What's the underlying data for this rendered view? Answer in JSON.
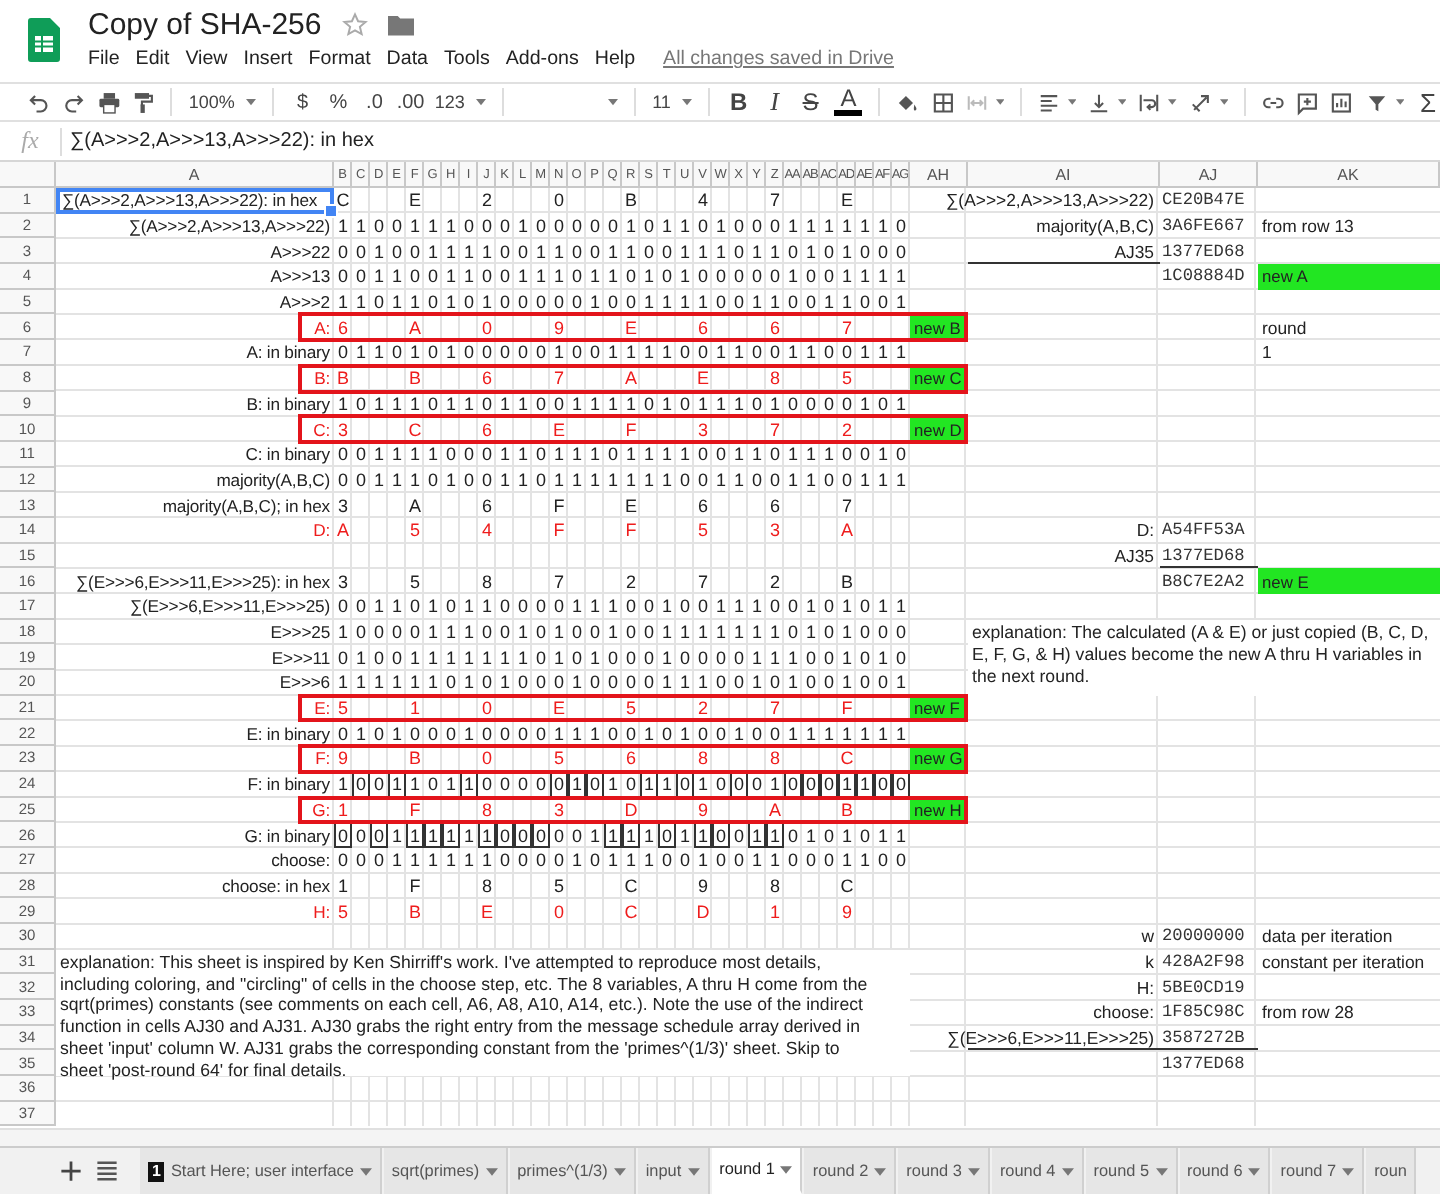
{
  "title": "Copy of SHA-256",
  "menu": [
    "File",
    "Edit",
    "View",
    "Insert",
    "Format",
    "Data",
    "Tools",
    "Add-ons",
    "Help"
  ],
  "save_status": "All changes saved in Drive",
  "toolbar": {
    "zoom": "100%",
    "currency": "$",
    "percent": "%",
    "decrease_decimals": ".0",
    "increase_decimals": ".00",
    "number_format": "123",
    "font_size": "11",
    "bold": "B",
    "italic": "I",
    "strikethrough": "S",
    "text_color": "A",
    "functions": "Σ"
  },
  "formula_bar": {
    "label": "fx",
    "value": "∑(A>>>2,A>>>13,A>>>22): in hex"
  },
  "column_headers": [
    "A",
    "B",
    "C",
    "D",
    "E",
    "F",
    "G",
    "H",
    "I",
    "J",
    "K",
    "L",
    "M",
    "N",
    "O",
    "P",
    "Q",
    "R",
    "S",
    "T",
    "U",
    "V",
    "W",
    "X",
    "Y",
    "Z",
    "AA",
    "AB",
    "AC",
    "AD",
    "AE",
    "AF",
    "AG",
    "AH",
    "AI",
    "AJ",
    "AK"
  ],
  "sheet_rows": [
    {
      "number": "1",
      "label": "∑(A>>>2,A>>>13,A>>>22): in hex",
      "kind": "hex",
      "selected": true,
      "values": [
        "C",
        "E",
        "2",
        "0",
        "B",
        "4",
        "7",
        "E"
      ],
      "side_label": "∑(A>>>2,A>>>13,A>>>22)",
      "side_value": "CE20B47E"
    },
    {
      "number": "2",
      "label": "∑(A>>>2,A>>>13,A>>>22)",
      "kind": "binary",
      "selected": false,
      "bits": [
        "1",
        "1",
        "0",
        "0",
        "1",
        "1",
        "1",
        "0",
        "0",
        "0",
        "1",
        "0",
        "0",
        "0",
        "0",
        "0",
        "1",
        "0",
        "1",
        "1",
        "0",
        "1",
        "0",
        "0",
        "0",
        "1",
        "1",
        "1",
        "1",
        "1",
        "1",
        "0"
      ],
      "side_label": "majority(A,B,C)",
      "side_value": "3A6FE667",
      "side_note": {
        "text": "from row 13",
        "kind": "plain"
      }
    },
    {
      "number": "3",
      "label": "A>>>22",
      "kind": "binary",
      "selected": false,
      "bits": [
        "0",
        "0",
        "1",
        "0",
        "0",
        "1",
        "1",
        "1",
        "1",
        "0",
        "0",
        "1",
        "1",
        "0",
        "0",
        "1",
        "1",
        "0",
        "0",
        "1",
        "1",
        "1",
        "0",
        "1",
        "1",
        "0",
        "1",
        "0",
        "1",
        "0",
        "0",
        "0"
      ],
      "side_label": "AJ35",
      "side_value": "1377ED68",
      "label_underlined": true,
      "value_underlined": false
    },
    {
      "number": "4",
      "label": "A>>>13",
      "kind": "binary",
      "selected": false,
      "bits": [
        "0",
        "0",
        "1",
        "1",
        "0",
        "0",
        "1",
        "1",
        "0",
        "0",
        "1",
        "1",
        "1",
        "0",
        "1",
        "1",
        "0",
        "1",
        "0",
        "1",
        "0",
        "0",
        "0",
        "0",
        "0",
        "1",
        "0",
        "0",
        "1",
        "1",
        "1",
        "1"
      ],
      "side_value": "1C08884D",
      "side_note": {
        "text": "new A",
        "kind": "tag"
      }
    },
    {
      "number": "5",
      "label": "A>>>2",
      "kind": "binary",
      "selected": false,
      "bits": [
        "1",
        "1",
        "0",
        "1",
        "1",
        "0",
        "1",
        "0",
        "1",
        "0",
        "0",
        "0",
        "0",
        "0",
        "1",
        "0",
        "0",
        "1",
        "1",
        "1",
        "1",
        "0",
        "0",
        "1",
        "1",
        "0",
        "0",
        "1",
        "1",
        "0",
        "0",
        "1"
      ]
    },
    {
      "number": "6",
      "label": "A:",
      "kind": "variable",
      "selected": false,
      "boxed": true,
      "tag": "new B",
      "values": [
        "6",
        "A",
        "0",
        "9",
        "E",
        "6",
        "6",
        "7"
      ],
      "side_note": {
        "text": "round",
        "kind": "plain"
      }
    },
    {
      "number": "7",
      "label": "A: in binary",
      "kind": "binary",
      "selected": false,
      "bits": [
        "0",
        "1",
        "1",
        "0",
        "1",
        "0",
        "1",
        "0",
        "0",
        "0",
        "0",
        "0",
        "1",
        "0",
        "0",
        "1",
        "1",
        "1",
        "1",
        "0",
        "0",
        "1",
        "1",
        "0",
        "0",
        "1",
        "1",
        "0",
        "0",
        "1",
        "1",
        "1"
      ],
      "side_note": {
        "text": "1",
        "kind": "plain"
      }
    },
    {
      "number": "8",
      "label": "B:",
      "kind": "variable",
      "selected": false,
      "boxed": true,
      "tag": "new C",
      "values": [
        "B",
        "B",
        "6",
        "7",
        "A",
        "E",
        "8",
        "5"
      ]
    },
    {
      "number": "9",
      "label": "B: in binary",
      "kind": "binary",
      "selected": false,
      "bits": [
        "1",
        "0",
        "1",
        "1",
        "1",
        "0",
        "1",
        "1",
        "0",
        "1",
        "1",
        "0",
        "0",
        "1",
        "1",
        "1",
        "1",
        "0",
        "1",
        "0",
        "1",
        "1",
        "1",
        "0",
        "1",
        "0",
        "0",
        "0",
        "0",
        "1",
        "0",
        "1"
      ]
    },
    {
      "number": "10",
      "label": "C:",
      "kind": "variable",
      "selected": false,
      "boxed": true,
      "tag": "new D",
      "values": [
        "3",
        "C",
        "6",
        "E",
        "F",
        "3",
        "7",
        "2"
      ]
    },
    {
      "number": "11",
      "label": "C: in binary",
      "kind": "binary",
      "selected": false,
      "bits": [
        "0",
        "0",
        "1",
        "1",
        "1",
        "1",
        "0",
        "0",
        "0",
        "1",
        "1",
        "0",
        "1",
        "1",
        "1",
        "0",
        "1",
        "1",
        "1",
        "1",
        "0",
        "0",
        "1",
        "1",
        "0",
        "1",
        "1",
        "1",
        "0",
        "0",
        "1",
        "0"
      ]
    },
    {
      "number": "12",
      "label": "majority(A,B,C)",
      "kind": "binary",
      "selected": false,
      "bits": [
        "0",
        "0",
        "1",
        "1",
        "1",
        "0",
        "1",
        "0",
        "0",
        "1",
        "1",
        "0",
        "1",
        "1",
        "1",
        "1",
        "1",
        "1",
        "1",
        "0",
        "0",
        "1",
        "1",
        "0",
        "0",
        "1",
        "1",
        "0",
        "0",
        "1",
        "1",
        "1"
      ]
    },
    {
      "number": "13",
      "label": "majority(A,B,C); in hex",
      "kind": "hex",
      "selected": false,
      "values": [
        "3",
        "A",
        "6",
        "F",
        "E",
        "6",
        "6",
        "7"
      ]
    },
    {
      "number": "14",
      "label": "D:",
      "kind": "variable",
      "selected": false,
      "boxed": false,
      "values": [
        "A",
        "5",
        "4",
        "F",
        "F",
        "5",
        "3",
        "A"
      ],
      "side_label": "D:",
      "side_value": "A54FF53A"
    },
    {
      "number": "15",
      "kind": "blank",
      "selected": false,
      "side_label": "AJ35",
      "side_value": "1377ED68",
      "label_underlined": false,
      "value_underlined": true
    },
    {
      "number": "16",
      "label": "∑(E>>>6,E>>>11,E>>>25): in hex",
      "kind": "hex",
      "selected": false,
      "values": [
        "3",
        "5",
        "8",
        "7",
        "2",
        "7",
        "2",
        "B"
      ],
      "side_value": "B8C7E2A2",
      "side_note": {
        "text": "new E",
        "kind": "tag"
      }
    },
    {
      "number": "17",
      "label": "∑(E>>>6,E>>>11,E>>>25)",
      "kind": "binary",
      "selected": false,
      "bits": [
        "0",
        "0",
        "1",
        "1",
        "0",
        "1",
        "0",
        "1",
        "1",
        "0",
        "0",
        "0",
        "0",
        "1",
        "1",
        "1",
        "0",
        "0",
        "1",
        "0",
        "0",
        "1",
        "1",
        "1",
        "0",
        "0",
        "1",
        "0",
        "1",
        "0",
        "1",
        "1"
      ]
    },
    {
      "number": "18",
      "label": "E>>>25",
      "kind": "binary",
      "selected": false,
      "bits": [
        "1",
        "0",
        "0",
        "0",
        "0",
        "1",
        "1",
        "1",
        "0",
        "0",
        "1",
        "0",
        "1",
        "0",
        "0",
        "1",
        "0",
        "0",
        "1",
        "1",
        "1",
        "1",
        "1",
        "1",
        "1",
        "0",
        "1",
        "0",
        "1",
        "0",
        "0",
        "0"
      ],
      "note": {
        "text": "explanation:  The calculated (A & E) or just copied (B, C, D, E, F, G, & H) values become the new A thru H variables in the next round.",
        "kind": "side"
      }
    },
    {
      "number": "19",
      "label": "E>>>11",
      "kind": "binary",
      "selected": false,
      "bits": [
        "0",
        "1",
        "0",
        "0",
        "1",
        "1",
        "1",
        "1",
        "1",
        "1",
        "1",
        "0",
        "1",
        "0",
        "1",
        "0",
        "0",
        "0",
        "1",
        "0",
        "0",
        "0",
        "0",
        "1",
        "1",
        "1",
        "0",
        "0",
        "1",
        "0",
        "1",
        "0"
      ]
    },
    {
      "number": "20",
      "label": "E>>>6",
      "kind": "binary",
      "selected": false,
      "bits": [
        "1",
        "1",
        "1",
        "1",
        "1",
        "1",
        "0",
        "1",
        "0",
        "1",
        "0",
        "0",
        "0",
        "1",
        "0",
        "0",
        "0",
        "0",
        "1",
        "1",
        "1",
        "0",
        "0",
        "1",
        "0",
        "1",
        "0",
        "0",
        "1",
        "0",
        "0",
        "1"
      ]
    },
    {
      "number": "21",
      "label": "E:",
      "kind": "variable",
      "selected": false,
      "boxed": true,
      "tag": "new F",
      "values": [
        "5",
        "1",
        "0",
        "E",
        "5",
        "2",
        "7",
        "F"
      ]
    },
    {
      "number": "22",
      "label": "E: in binary",
      "kind": "binary",
      "selected": false,
      "bits": [
        "0",
        "1",
        "0",
        "1",
        "0",
        "0",
        "0",
        "1",
        "0",
        "0",
        "0",
        "0",
        "1",
        "1",
        "1",
        "0",
        "0",
        "1",
        "0",
        "1",
        "0",
        "0",
        "1",
        "0",
        "0",
        "1",
        "1",
        "1",
        "1",
        "1",
        "1",
        "1"
      ]
    },
    {
      "number": "23",
      "label": "F:",
      "kind": "variable",
      "selected": false,
      "boxed": true,
      "tag": "new G",
      "values": [
        "9",
        "B",
        "0",
        "5",
        "6",
        "8",
        "8",
        "C"
      ]
    },
    {
      "number": "24",
      "label": "F: in binary",
      "kind": "binary",
      "selected": false,
      "bits": [
        {
          "digit": "1",
          "circled": false
        },
        {
          "digit": "0",
          "circled": true
        },
        {
          "digit": "0",
          "circled": false
        },
        {
          "digit": "1",
          "circled": true
        },
        {
          "digit": "1",
          "circled": false
        },
        {
          "digit": "0",
          "circled": false
        },
        {
          "digit": "1",
          "circled": false
        },
        {
          "digit": "1",
          "circled": true
        },
        {
          "digit": "0",
          "circled": false
        },
        {
          "digit": "0",
          "circled": false
        },
        {
          "digit": "0",
          "circled": false
        },
        {
          "digit": "0",
          "circled": false
        },
        {
          "digit": "0",
          "circled": true
        },
        {
          "digit": "1",
          "circled": true
        },
        {
          "digit": "0",
          "circled": true
        },
        {
          "digit": "1",
          "circled": false
        },
        {
          "digit": "0",
          "circled": false
        },
        {
          "digit": "1",
          "circled": true
        },
        {
          "digit": "1",
          "circled": false
        },
        {
          "digit": "0",
          "circled": true
        },
        {
          "digit": "1",
          "circled": false
        },
        {
          "digit": "0",
          "circled": false
        },
        {
          "digit": "0",
          "circled": true
        },
        {
          "digit": "0",
          "circled": false
        },
        {
          "digit": "1",
          "circled": false
        },
        {
          "digit": "0",
          "circled": true
        },
        {
          "digit": "0",
          "circled": true
        },
        {
          "digit": "0",
          "circled": true
        },
        {
          "digit": "1",
          "circled": true
        },
        {
          "digit": "1",
          "circled": true
        },
        {
          "digit": "0",
          "circled": true
        },
        {
          "digit": "0",
          "circled": true
        }
      ]
    },
    {
      "number": "25",
      "label": "G:",
      "kind": "variable",
      "selected": false,
      "boxed": true,
      "tag": "new H",
      "values": [
        "1",
        "F",
        "8",
        "3",
        "D",
        "9",
        "A",
        "B"
      ]
    },
    {
      "number": "26",
      "label": "G: in binary",
      "kind": "binary",
      "selected": false,
      "bits": [
        {
          "digit": "0",
          "circled": true
        },
        {
          "digit": "0",
          "circled": false
        },
        {
          "digit": "0",
          "circled": true
        },
        {
          "digit": "1",
          "circled": false
        },
        {
          "digit": "1",
          "circled": true
        },
        {
          "digit": "1",
          "circled": true
        },
        {
          "digit": "1",
          "circled": true
        },
        {
          "digit": "1",
          "circled": false
        },
        {
          "digit": "1",
          "circled": true
        },
        {
          "digit": "0",
          "circled": true
        },
        {
          "digit": "0",
          "circled": true
        },
        {
          "digit": "0",
          "circled": true
        },
        {
          "digit": "0",
          "circled": false
        },
        {
          "digit": "0",
          "circled": false
        },
        {
          "digit": "1",
          "circled": false
        },
        {
          "digit": "1",
          "circled": true
        },
        {
          "digit": "1",
          "circled": true
        },
        {
          "digit": "1",
          "circled": false
        },
        {
          "digit": "0",
          "circled": true
        },
        {
          "digit": "1",
          "circled": false
        },
        {
          "digit": "1",
          "circled": true
        },
        {
          "digit": "0",
          "circled": true
        },
        {
          "digit": "0",
          "circled": false
        },
        {
          "digit": "1",
          "circled": true
        },
        {
          "digit": "1",
          "circled": true
        },
        {
          "digit": "0",
          "circled": false
        },
        {
          "digit": "1",
          "circled": false
        },
        {
          "digit": "0",
          "circled": false
        },
        {
          "digit": "1",
          "circled": false
        },
        {
          "digit": "0",
          "circled": false
        },
        {
          "digit": "1",
          "circled": false
        },
        {
          "digit": "1",
          "circled": false
        }
      ]
    },
    {
      "number": "27",
      "label": "choose:",
      "kind": "binary",
      "selected": false,
      "bits": [
        "0",
        "0",
        "0",
        "1",
        "1",
        "1",
        "1",
        "1",
        "1",
        "0",
        "0",
        "0",
        "0",
        "1",
        "0",
        "1",
        "1",
        "1",
        "0",
        "0",
        "1",
        "0",
        "0",
        "1",
        "1",
        "0",
        "0",
        "0",
        "1",
        "1",
        "0",
        "0"
      ]
    },
    {
      "number": "28",
      "label": "choose: in hex",
      "kind": "hex",
      "selected": false,
      "values": [
        "1",
        "F",
        "8",
        "5",
        "C",
        "9",
        "8",
        "C"
      ]
    },
    {
      "number": "29",
      "label": "H:",
      "kind": "variable",
      "selected": false,
      "boxed": false,
      "values": [
        "5",
        "B",
        "E",
        "0",
        "C",
        "D",
        "1",
        "9"
      ]
    },
    {
      "number": "30",
      "kind": "blank",
      "selected": false,
      "side_label": "w",
      "side_value": "20000000",
      "side_note": {
        "text": "data per iteration",
        "kind": "plain"
      }
    },
    {
      "number": "31",
      "kind": "blank",
      "selected": false,
      "side_label": "k",
      "side_value": "428A2F98",
      "side_note": {
        "text": "constant per iteration",
        "kind": "plain"
      },
      "note": {
        "kind": "wide",
        "text": "explanation:  This sheet is inspired by Ken Shirriff's work.  I've attempted to reproduce most details, including coloring, and \"circling\" of cells in the choose step, etc.  The 8 variables, A thru H come from the sqrt(primes) constants (see comments on each cell, A6, A8, A10, A14, etc.).  Note the use of the indirect function in cells AJ30 and AJ31.  AJ30 grabs the right entry from the message schedule array derived in sheet 'input' column W.  AJ31 grabs the corresponding constant from the 'primes^(1/3)' sheet.  Skip to sheet 'post-round 64' for final details."
      }
    },
    {
      "number": "32",
      "kind": "blank",
      "selected": false,
      "side_label": "H:",
      "side_value": "5BE0CD19"
    },
    {
      "number": "33",
      "kind": "blank",
      "selected": false,
      "side_label": "choose:",
      "side_value": "1F85C98C",
      "side_note": {
        "text": "from row 28",
        "kind": "plain"
      }
    },
    {
      "number": "34",
      "kind": "blank",
      "selected": false,
      "side_label": "∑(E>>>6,E>>>11,E>>>25)",
      "side_value": "3587272B",
      "label_underlined": true,
      "value_underlined": true
    },
    {
      "number": "35",
      "kind": "blank",
      "selected": false,
      "side_value": "1377ED68"
    },
    {
      "number": "36",
      "kind": "blank",
      "selected": false
    },
    {
      "number": "37",
      "kind": "blank",
      "selected": false
    }
  ],
  "tabs": [
    {
      "label": "Start Here; user interface",
      "badge": "1",
      "selected": false
    },
    {
      "label": "sqrt(primes)",
      "selected": false
    },
    {
      "label": "primes^(1/3)",
      "selected": false
    },
    {
      "label": "input",
      "selected": false
    },
    {
      "label": "round 1",
      "selected": true
    },
    {
      "label": "round 2",
      "selected": false
    },
    {
      "label": "round 3",
      "selected": false
    },
    {
      "label": "round 4",
      "selected": false
    },
    {
      "label": "round 5",
      "selected": false
    },
    {
      "label": "round 6",
      "selected": false
    },
    {
      "label": "round 7",
      "selected": false
    },
    {
      "label": "roun",
      "selected": false
    }
  ]
}
